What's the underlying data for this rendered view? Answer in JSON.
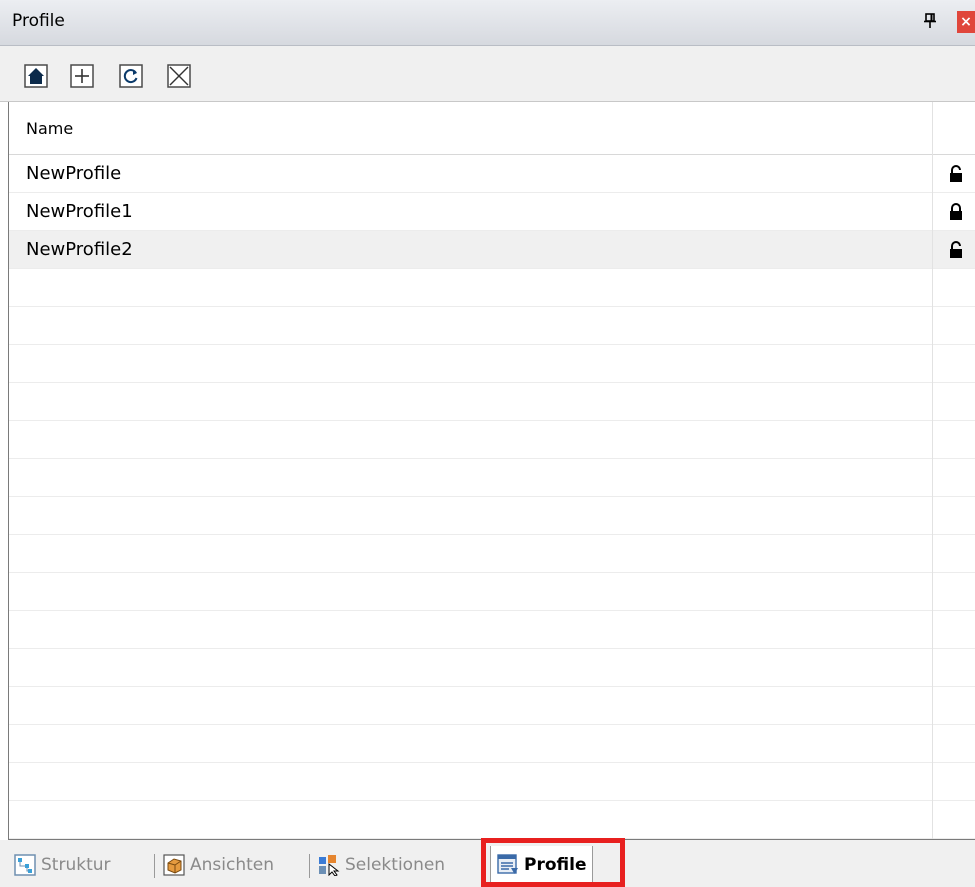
{
  "panel": {
    "title": "Profile"
  },
  "toolbar": {
    "buttons": [
      {
        "icon": "home-icon"
      },
      {
        "icon": "add-icon"
      },
      {
        "icon": "refresh-icon"
      },
      {
        "icon": "delete-icon"
      }
    ]
  },
  "grid": {
    "column_header": "Name",
    "rows": [
      {
        "name": "NewProfile",
        "icon": "unlock-icon"
      },
      {
        "name": "NewProfile1",
        "icon": "lock-icon"
      },
      {
        "name": "NewProfile2",
        "icon": "unlock-icon",
        "selected": true
      }
    ]
  },
  "tabs": [
    {
      "label": "Struktur",
      "icon": "structure-icon"
    },
    {
      "label": "Ansichten",
      "icon": "views-icon"
    },
    {
      "label": "Selektionen",
      "icon": "selections-icon"
    },
    {
      "label": "Profile",
      "icon": "profile-icon",
      "active": true
    }
  ],
  "colors": {
    "highlight": "#e8201f",
    "close": "#e0463b"
  }
}
